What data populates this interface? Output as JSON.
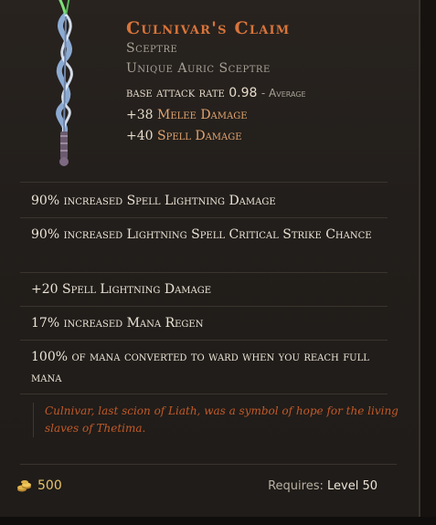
{
  "item": {
    "name": "Culnivar's Claim",
    "type": "Sceptre",
    "subtype": "Unique Auric Sceptre",
    "base_attack_rate_label": "base attack rate",
    "base_attack_rate_value": "0.98",
    "base_attack_rate_note": "- Average",
    "implicits": [
      {
        "value": "+38",
        "stat": "Melee Damage"
      },
      {
        "value": "+40",
        "stat": "Spell Damage"
      }
    ],
    "affixes": [
      "90% increased Spell Lightning Damage",
      "90% increased Lightning Spell Critical Strike Chance",
      "+20 Spell Lightning Damage",
      "17% increased Mana Regen",
      "100% of mana converted to ward when you reach full mana"
    ],
    "lore": "Culnivar, last scion of Liath, was a symbol of hope for the living slaves of Thetima.",
    "gold_value": "500",
    "requires_label": "Requires:",
    "requires_level": "Level 50",
    "icons": {
      "item_art": "sceptre-icon",
      "gold": "gold-coin-icon"
    },
    "colors": {
      "name": "#d9743a",
      "stat_highlight": "#e2a46f",
      "lore": "#c25a28",
      "gold": "#e8c36a"
    }
  }
}
